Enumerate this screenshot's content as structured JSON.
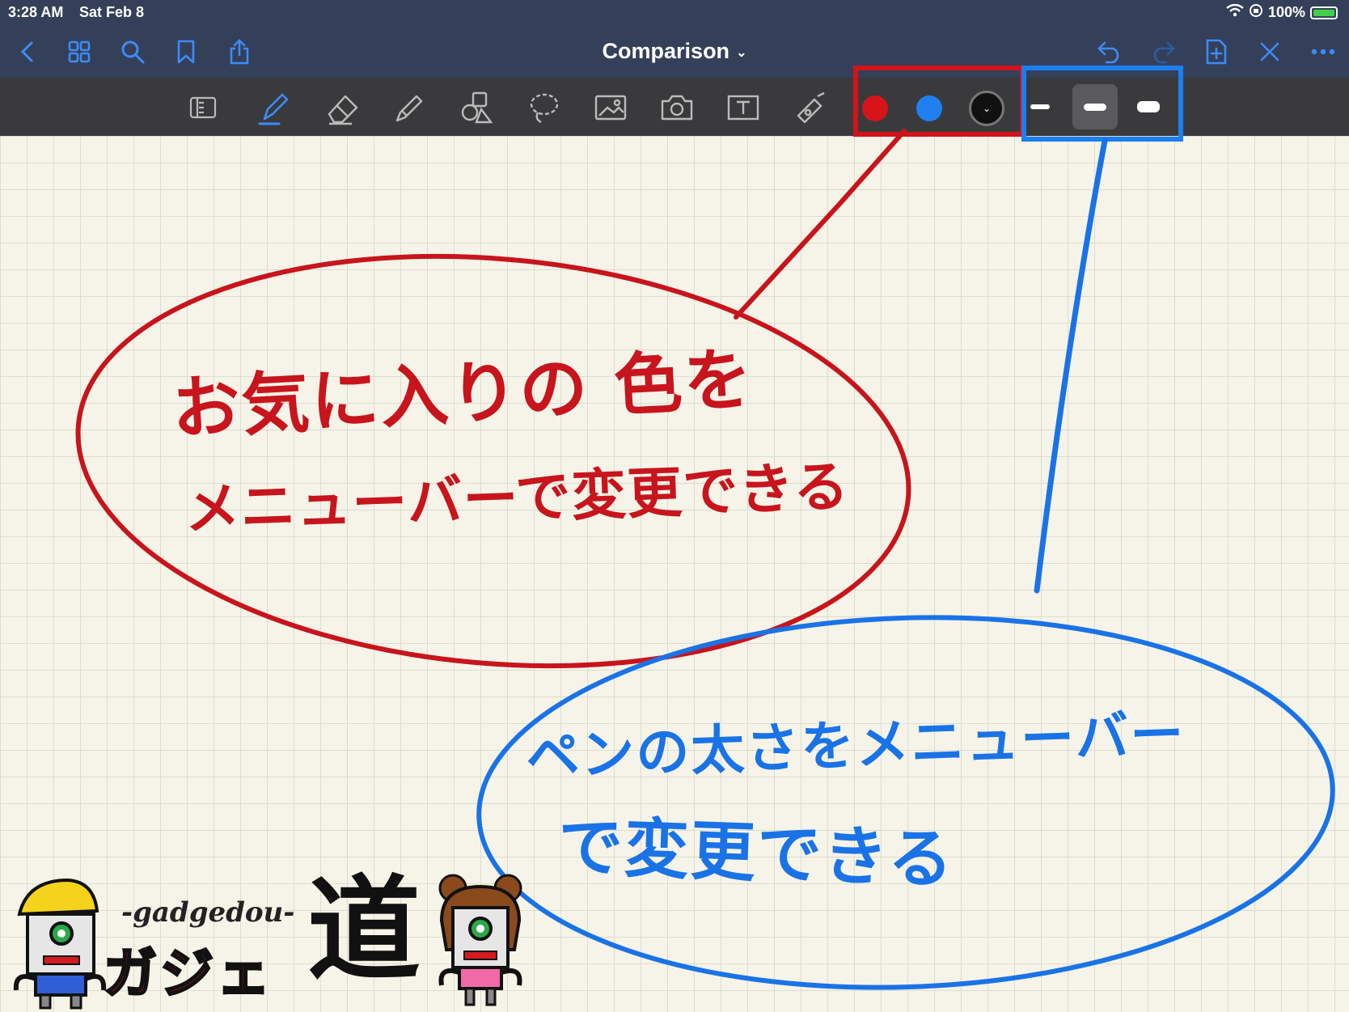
{
  "status_bar": {
    "time": "3:28 AM",
    "date": "Sat Feb 8",
    "battery": "100%",
    "icons": [
      "wifi-icon",
      "orientation-lock-icon",
      "battery-charging-icon"
    ]
  },
  "nav": {
    "title": "Comparison",
    "left_icons": [
      "back-icon",
      "grid-icon",
      "search-icon",
      "bookmark-icon",
      "share-icon"
    ],
    "right_icons": [
      "undo-icon",
      "redo-icon",
      "add-page-icon",
      "close-icon",
      "more-icon"
    ]
  },
  "toolbar": {
    "tools": [
      "read-only-icon",
      "pen-icon",
      "eraser-icon",
      "highlighter-icon",
      "shapes-icon",
      "lasso-icon",
      "image-icon",
      "camera-icon",
      "text-icon",
      "laser-pointer-icon"
    ],
    "colors": [
      "#d7141a",
      "#1f7ff0",
      "#111111"
    ],
    "sizes": [
      "thin",
      "medium",
      "thick"
    ],
    "selected_size": "medium"
  },
  "annotations": {
    "red_text_line1": "お気に入りの 色を",
    "red_text_line2": "メニューバーで変更できる",
    "blue_text_line1": "ペンの太さをメニューバー",
    "blue_text_line2": "で変更できる",
    "colors": {
      "red": "#c8141c",
      "blue": "#1a73e6"
    }
  },
  "logo": {
    "roman": "-gadgedou-",
    "kana": "ガジェ",
    "kanji": "道"
  }
}
